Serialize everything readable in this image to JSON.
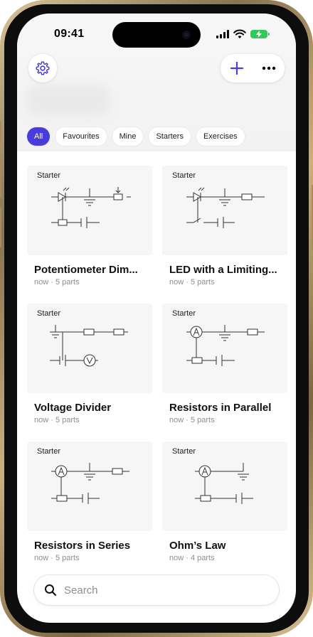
{
  "status": {
    "time": "09:41"
  },
  "filters": [
    {
      "label": "All",
      "active": true
    },
    {
      "label": "Favourites",
      "active": false
    },
    {
      "label": "Mine",
      "active": false
    },
    {
      "label": "Starters",
      "active": false
    },
    {
      "label": "Exercises",
      "active": false
    }
  ],
  "cards": [
    {
      "badge": "Starter",
      "title": "Potentiometer Dim...",
      "meta": "now · 5 parts"
    },
    {
      "badge": "Starter",
      "title": "LED with a Limiting...",
      "meta": "now · 5 parts"
    },
    {
      "badge": "Starter",
      "title": "Voltage Divider",
      "meta": "now · 5 parts"
    },
    {
      "badge": "Starter",
      "title": "Resistors in Parallel",
      "meta": "now · 5 parts"
    },
    {
      "badge": "Starter",
      "title": "Resistors in Series",
      "meta": "now · 5 parts"
    },
    {
      "badge": "Starter",
      "title": "Ohm’s Law",
      "meta": "now · 4 parts"
    }
  ],
  "search": {
    "placeholder": "Search"
  },
  "icons": {
    "settings": "gear-icon",
    "add": "plus-icon",
    "more": "ellipsis-icon",
    "search": "magnifier-icon"
  },
  "colors": {
    "accent": "#4a3bdc",
    "battery": "#34c759"
  }
}
